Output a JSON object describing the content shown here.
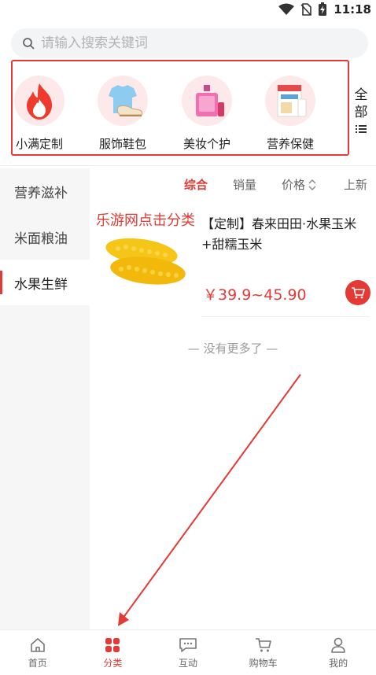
{
  "status_bar": {
    "time": "11:18"
  },
  "search": {
    "placeholder": "请输入搜索关键词"
  },
  "categories": [
    {
      "label": "小满定制",
      "icon": "fire-icon"
    },
    {
      "label": "服饰鞋包",
      "icon": "clothes-shoes-icon"
    },
    {
      "label": "美妆个护",
      "icon": "perfume-icon"
    },
    {
      "label": "营养保健",
      "icon": "milk-powder-icon"
    }
  ],
  "category_all": {
    "line1": "全",
    "line2": "部"
  },
  "sidebar": {
    "items": [
      {
        "label": "营养滋补"
      },
      {
        "label": "米面粮油"
      },
      {
        "label": "水果生鲜"
      }
    ],
    "active_index": 2
  },
  "sort_bar": {
    "comprehensive": "综合",
    "sales": "销量",
    "price": "价格",
    "newest": "上新"
  },
  "watermark": "乐游网点击分类",
  "product": {
    "title": "【定制】春来田田·水果玉米+甜糯玉米",
    "price": "￥39.9~45.90",
    "image": "corn-image"
  },
  "list_end": "— 没有更多了 —",
  "tabbar": {
    "items": [
      {
        "label": "首页",
        "icon": "home-icon"
      },
      {
        "label": "分类",
        "icon": "category-icon"
      },
      {
        "label": "互动",
        "icon": "chat-icon"
      },
      {
        "label": "购物车",
        "icon": "cart-icon"
      },
      {
        "label": "我的",
        "icon": "user-icon"
      }
    ],
    "active_index": 1
  },
  "colors": {
    "accent": "#e53935",
    "sidebar_bg": "#f6f6f6",
    "search_bg": "#f3f4f6"
  }
}
